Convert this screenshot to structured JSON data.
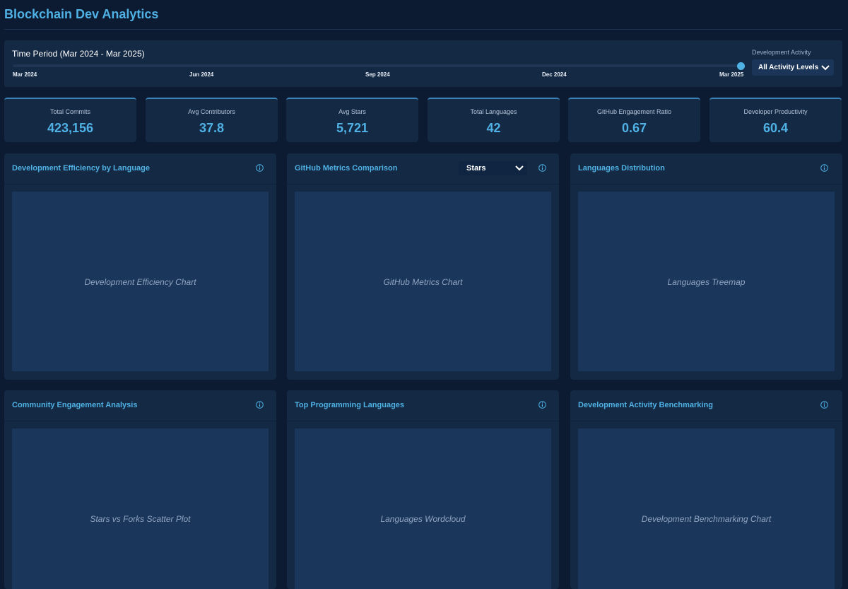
{
  "app": {
    "title": "Blockchain Dev Analytics"
  },
  "filters": {
    "time_period_label": "Time Period (Mar 2024 - Mar 2025)",
    "slider_ticks": [
      "Mar 2024",
      "Jun 2024",
      "Sep 2024",
      "Dec 2024",
      "Mar 2025"
    ],
    "slider_position": 1.0,
    "activity_label": "Development Activity",
    "activity_value": "All Activity Levels"
  },
  "kpis": [
    {
      "label": "Total Commits",
      "value": "423,156"
    },
    {
      "label": "Avg Contributors",
      "value": "37.8"
    },
    {
      "label": "Avg Stars",
      "value": "5,721"
    },
    {
      "label": "Total Languages",
      "value": "42"
    },
    {
      "label": "GitHub Engagement Ratio",
      "value": "0.67"
    },
    {
      "label": "Developer Productivity",
      "value": "60.4"
    }
  ],
  "cards": [
    {
      "title": "Development Efficiency by Language",
      "placeholder": "Development Efficiency Chart"
    },
    {
      "title": "GitHub Metrics Comparison",
      "placeholder": "GitHub Metrics Chart",
      "select_value": "Stars"
    },
    {
      "title": "Languages Distribution",
      "placeholder": "Languages Treemap"
    },
    {
      "title": "Community Engagement Analysis",
      "placeholder": "Stars vs Forks Scatter Plot"
    },
    {
      "title": "Top Programming Languages",
      "placeholder": "Languages Wordcloud"
    },
    {
      "title": "Development Activity Benchmarking",
      "placeholder": "Development Benchmarking Chart"
    }
  ],
  "icons": {
    "info": "info-icon",
    "dropdown": "chevron-down-icon"
  },
  "colors": {
    "background": "#0c1a32",
    "panel": "#142944",
    "accent": "#4fb1e4",
    "placeholder": "#1b365b"
  }
}
